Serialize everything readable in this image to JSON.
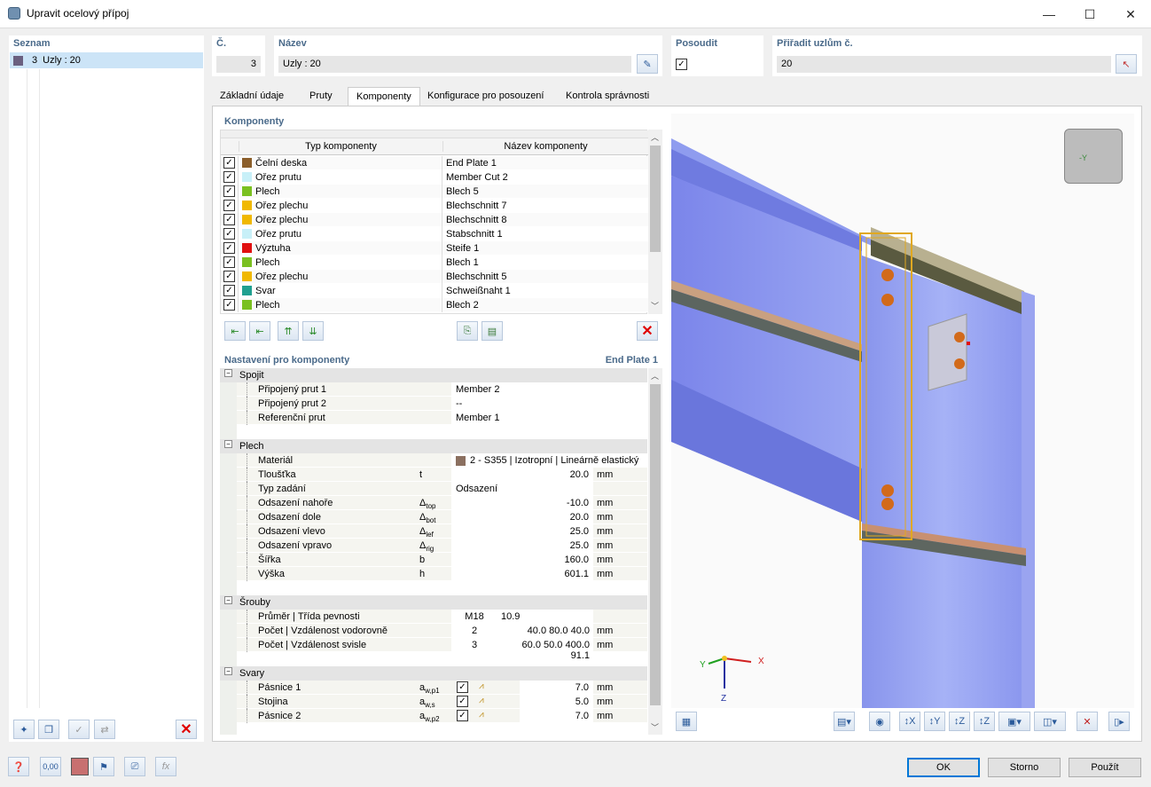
{
  "window": {
    "title": "Upravit ocelový přípoj",
    "min": "—",
    "max": "☐",
    "close": "✕"
  },
  "seznam": {
    "header": "Seznam",
    "item_num": "3",
    "item_label": "Uzly : 20"
  },
  "cislo": {
    "label": "Č.",
    "value": "3"
  },
  "nazev": {
    "label": "Název",
    "value": "Uzly : 20"
  },
  "posoudit": {
    "label": "Posoudit"
  },
  "priradit": {
    "label": "Přiřadit uzlům č.",
    "value": "20"
  },
  "tabs": [
    "Základní údaje",
    "Pruty",
    "Komponenty",
    "Konfigurace pro posouzení",
    "Kontrola správnosti"
  ],
  "komponenty": {
    "header": "Komponenty",
    "col_type": "Typ komponenty",
    "col_name": "Název komponenty",
    "rows": [
      {
        "type": "Čelní deska",
        "name": "End Plate 1",
        "color": "#8b5e2a"
      },
      {
        "type": "Ořez prutu",
        "name": "Member Cut 2",
        "color": "#c8f0f8"
      },
      {
        "type": "Plech",
        "name": "Blech 5",
        "color": "#7ac020"
      },
      {
        "type": "Ořez plechu",
        "name": "Blechschnitt 7",
        "color": "#f0b800"
      },
      {
        "type": "Ořez plechu",
        "name": "Blechschnitt 8",
        "color": "#f0b800"
      },
      {
        "type": "Ořez prutu",
        "name": "Stabschnitt 1",
        "color": "#c8f0f8"
      },
      {
        "type": "Výztuha",
        "name": "Steife 1",
        "color": "#e01010"
      },
      {
        "type": "Plech",
        "name": "Blech 1",
        "color": "#7ac020"
      },
      {
        "type": "Ořez plechu",
        "name": "Blechschnitt 5",
        "color": "#f0b800"
      },
      {
        "type": "Svar",
        "name": "Schweißnaht 1",
        "color": "#20a090"
      },
      {
        "type": "Plech",
        "name": "Blech 2",
        "color": "#7ac020"
      }
    ]
  },
  "nastaveni": {
    "header": "Nastavení pro komponenty",
    "current": "End Plate 1",
    "spojit": {
      "title": "Spojit",
      "rows": [
        {
          "label": "Připojený prut 1",
          "value": "Member 2"
        },
        {
          "label": "Připojený prut 2",
          "value": "--"
        },
        {
          "label": "Referenční prut",
          "value": "Member 1"
        }
      ]
    },
    "plech": {
      "title": "Plech",
      "material_label": "Materiál",
      "material_value": "2 - S355 | Izotropní | Lineárně elastický",
      "material_color": "#8b7060",
      "rows": [
        {
          "label": "Tloušťka",
          "sym": "t",
          "sub": "",
          "value": "20.0",
          "unit": "mm"
        },
        {
          "label": "Typ zadání",
          "sym": "",
          "sub": "",
          "value": "Odsazení",
          "unit": ""
        },
        {
          "label": "Odsazení nahoře",
          "sym": "Δ",
          "sub": "top",
          "value": "-10.0",
          "unit": "mm"
        },
        {
          "label": "Odsazení dole",
          "sym": "Δ",
          "sub": "bot",
          "value": "20.0",
          "unit": "mm"
        },
        {
          "label": "Odsazení vlevo",
          "sym": "Δ",
          "sub": "lef",
          "value": "25.0",
          "unit": "mm"
        },
        {
          "label": "Odsazení vpravo",
          "sym": "Δ",
          "sub": "rig",
          "value": "25.0",
          "unit": "mm"
        },
        {
          "label": "Šířka",
          "sym": "b",
          "sub": "",
          "value": "160.0",
          "unit": "mm"
        },
        {
          "label": "Výška",
          "sym": "h",
          "sub": "",
          "value": "601.1",
          "unit": "mm"
        }
      ]
    },
    "srouby": {
      "title": "Šrouby",
      "rows": [
        {
          "label": "Průměr | Třída pevnosti",
          "a": "M18",
          "b": "10.9",
          "unit": ""
        },
        {
          "label": "Počet | Vzdálenost vodorovně",
          "a": "2",
          "b": "40.0 80.0 40.0",
          "unit": "mm"
        },
        {
          "label": "Počet | Vzdálenost svisle",
          "a": "3",
          "b": "60.0 50.0 400.0 91.1",
          "unit": "mm"
        }
      ]
    },
    "svary": {
      "title": "Svary",
      "rows": [
        {
          "label": "Pásnice 1",
          "sym": "a",
          "sub": "w,p1",
          "value": "7.0",
          "unit": "mm"
        },
        {
          "label": "Stojina",
          "sym": "a",
          "sub": "w,s",
          "value": "5.0",
          "unit": "mm"
        },
        {
          "label": "Pásnice 2",
          "sym": "a",
          "sub": "w,p2",
          "value": "7.0",
          "unit": "mm"
        }
      ]
    }
  },
  "axes": {
    "x": "X",
    "y": "Y",
    "z": "Z"
  },
  "viewcube": {
    "label": "-Y"
  },
  "bottom_icons": {
    "zero": "0,00",
    "fx": "fx"
  },
  "buttons": {
    "ok": "OK",
    "storno": "Storno",
    "pouzit": "Použít"
  },
  "accent": "#4a6a8a"
}
